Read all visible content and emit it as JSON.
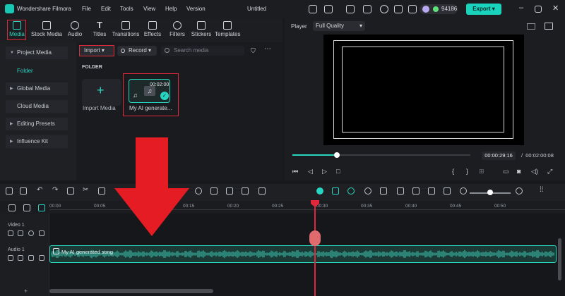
{
  "app": {
    "name": "Wondershare Filmora",
    "project_title": "Untitled",
    "credits": "94186",
    "export_label": "Export"
  },
  "menu": [
    "File",
    "Edit",
    "Tools",
    "View",
    "Help",
    "Version"
  ],
  "media_tabs": [
    "Media",
    "Stock Media",
    "Audio",
    "Titles",
    "Transitions",
    "Effects",
    "Filters",
    "Stickers",
    "Templates"
  ],
  "left_nav": {
    "project_media": "Project Media",
    "folder": "Folder",
    "global_media": "Global Media",
    "cloud_media": "Cloud Media",
    "editing_presets": "Editing Presets",
    "influence_kit": "Influence Kit"
  },
  "media_panel": {
    "import_label": "Import",
    "record_label": "Record",
    "search_placeholder": "Search media",
    "folder_heading": "FOLDER",
    "import_tile_label": "Import Media",
    "clip": {
      "duration": "00:02:00",
      "name": "My AI generate..."
    }
  },
  "player": {
    "label": "Player",
    "quality": "Full Quality",
    "current_time": "00:00:29:16",
    "separator": "/",
    "total_time": "00:02:00:08",
    "progress": 0.25
  },
  "ruler": [
    "00:00",
    "00:05",
    "00:10",
    "00:15",
    "00:20",
    "00:25",
    "00:30",
    "00:35",
    "00:40",
    "00:45",
    "00:50"
  ],
  "tracks": {
    "video": "Video 1",
    "audio": "Audio 1",
    "audio_clip_name": "My AI generated song"
  },
  "colors": {
    "accent": "#27d6c1",
    "highlight": "#e0283a",
    "export": "#19d3bd"
  },
  "icons": {
    "logo": "filmora-logo-icon",
    "add_track": "+"
  }
}
